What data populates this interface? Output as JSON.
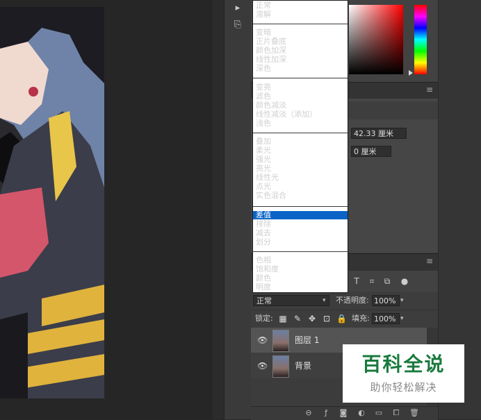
{
  "blend_menu": {
    "groups": [
      [
        "正常",
        "溶解"
      ],
      [
        "变暗",
        "正片叠底",
        "颜色加深",
        "线性加深",
        "深色"
      ],
      [
        "变亮",
        "滤色",
        "颜色减淡",
        "线性减淡（添加）",
        "浅色"
      ],
      [
        "叠加",
        "柔光",
        "强光",
        "亮光",
        "线性光",
        "点光",
        "实色混合"
      ],
      [
        "差值",
        "排除",
        "减去",
        "划分"
      ],
      [
        "色相",
        "饱和度",
        "颜色",
        "明度"
      ]
    ],
    "highlighted": "差值"
  },
  "properties": {
    "width_value": "42.33 厘米",
    "x_value": "0 厘米"
  },
  "layers_panel": {
    "blend_mode": "正常",
    "opacity_label": "不透明度:",
    "opacity_value": "100%",
    "lock_label": "锁定:",
    "fill_label": "填充:",
    "fill_value": "100%",
    "layers": [
      {
        "name": "图层 1",
        "selected": true,
        "visible": true
      },
      {
        "name": "背景",
        "selected": false,
        "visible": true
      }
    ]
  },
  "colors": {
    "highlight": "#0a64c8",
    "selected_layer": "#545454",
    "watermark_green": "#1a7a3e"
  },
  "watermark": {
    "title": "百科全说",
    "subtitle": "助你轻松解决"
  }
}
